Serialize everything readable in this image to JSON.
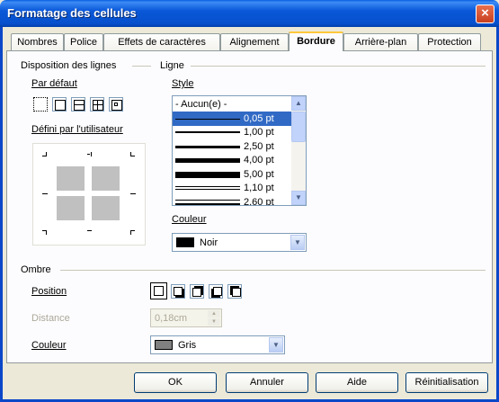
{
  "window": {
    "title": "Formatage des cellules",
    "close_glyph": "×"
  },
  "tabs": [
    {
      "label": "Nombres",
      "active": false
    },
    {
      "label": "Police",
      "active": false
    },
    {
      "label": "Effets de caractères",
      "active": false
    },
    {
      "label": "Alignement",
      "active": false
    },
    {
      "label": "Bordure",
      "active": true
    },
    {
      "label": "Arrière-plan",
      "active": false
    },
    {
      "label": "Protection",
      "active": false
    }
  ],
  "line_arrangement": {
    "section_title": "Disposition des lignes",
    "default_label": "Par défaut",
    "presets": [
      "no-border-icon",
      "outer-border-icon",
      "outer-horizontal-icon",
      "outer-all-inner-icon",
      "outer-inner-icon"
    ],
    "user_defined_label": "Défini par l'utilisateur"
  },
  "line": {
    "section_title": "Ligne",
    "style_label": "Style",
    "styles": [
      {
        "label": "- Aucun(e) -",
        "weight": 0,
        "double": false
      },
      {
        "label": "0,05 pt",
        "weight": 1,
        "double": false,
        "selected": true
      },
      {
        "label": "1,00 pt",
        "weight": 2,
        "double": false
      },
      {
        "label": "2,50 pt",
        "weight": 3,
        "double": false
      },
      {
        "label": "4,00 pt",
        "weight": 5,
        "double": false
      },
      {
        "label": "5,00 pt",
        "weight": 7,
        "double": false
      },
      {
        "label": "1,10 pt",
        "weight": 1,
        "double": true
      },
      {
        "label": "2,60 pt",
        "weight": 2,
        "double": true
      }
    ],
    "color_label": "Couleur",
    "color_value": "Noir",
    "color_swatch": "#000000"
  },
  "shadow": {
    "section_title": "Ombre",
    "position_label": "Position",
    "positions": [
      "no-shadow-icon",
      "shadow-bottom-right-icon",
      "shadow-top-right-icon",
      "shadow-bottom-left-icon",
      "shadow-top-left-icon"
    ],
    "distance_label": "Distance",
    "distance_value": "0,18cm",
    "color_label": "Couleur",
    "color_value": "Gris",
    "color_swatch": "#808080"
  },
  "buttons": {
    "ok": "OK",
    "cancel": "Annuler",
    "help": "Aide",
    "reset": "Réinitialisation"
  },
  "colors": {
    "titlebar": "#0a58d8",
    "selection": "#316ac5",
    "tab_highlight": "#ffc83c"
  }
}
